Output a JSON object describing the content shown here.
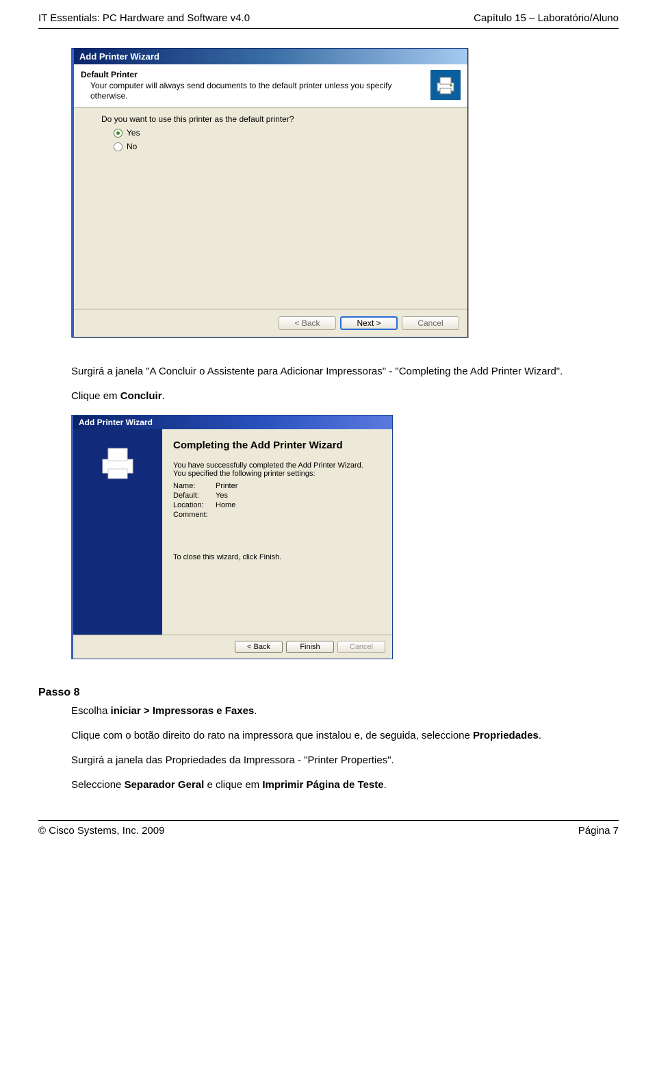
{
  "header": {
    "left": "IT Essentials: PC Hardware and Software v4.0",
    "right": "Capítulo 15 – Laboratório/Aluno"
  },
  "wizard1": {
    "title": "Add Printer Wizard",
    "heading": "Default Printer",
    "subheading": "Your computer will always send documents to the default printer unless you specify otherwise.",
    "question": "Do you want to use this printer as the default printer?",
    "option_yes": "Yes",
    "option_no": "No",
    "btn_back": "< Back",
    "btn_next": "Next >",
    "btn_cancel": "Cancel"
  },
  "para1_a": "Surgirá a janela \"A Concluir o Assistente para Adicionar Impressoras\" -  \"Completing the Add Printer Wizard\".",
  "para1_b_pre": "Clique em ",
  "para1_b_bold": "Concluir",
  "wizard2": {
    "title": "Add Printer Wizard",
    "heading": "Completing the Add Printer Wizard",
    "success1": "You have successfully completed the Add Printer Wizard.",
    "success2": "You specified the following printer settings:",
    "labels": {
      "name": "Name:",
      "default": "Default:",
      "location": "Location:",
      "comment": "Comment:"
    },
    "values": {
      "name": "Printer",
      "default": "Yes",
      "location": "Home",
      "comment": ""
    },
    "close_hint": "To close this wizard, click Finish.",
    "btn_back": "< Back",
    "btn_finish": "Finish",
    "btn_cancel": "Cancel"
  },
  "step8": {
    "heading": "Passo 8",
    "p1_pre": "Escolha ",
    "p1_bold": "iniciar > Impressoras e Faxes",
    "p2_a": "Clique com o botão direito do rato na impressora que instalou e, de seguida, seleccione ",
    "p2_bold": "Propriedades",
    "p3": "Surgirá a janela das Propriedades da Impressora - \"Printer Properties\".",
    "p4_a": "Seleccione ",
    "p4_bold1": "Separador Geral",
    "p4_b": " e clique em ",
    "p4_bold2": "Imprimir Página de Teste"
  },
  "footer": {
    "left": "© Cisco Systems, Inc. 2009",
    "right": "Página 7"
  }
}
